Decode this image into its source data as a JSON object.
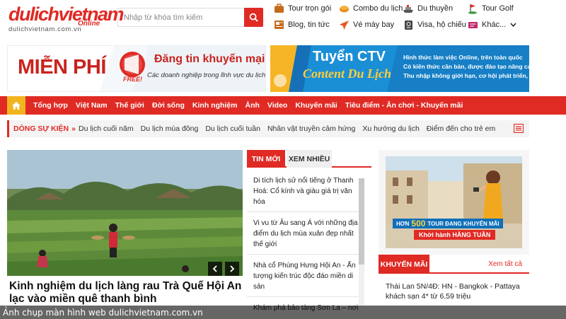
{
  "logo": {
    "main": "dulichvietnam",
    "online": "Online",
    "sub": "dulichvietnam.com.vn"
  },
  "search": {
    "placeholder": "Nhập từ khóa tìm kiếm"
  },
  "quick_links": [
    {
      "label": "Tour trọn gói",
      "icon": "briefcase-icon"
    },
    {
      "label": "Combo du lịch",
      "icon": "combo-icon"
    },
    {
      "label": "Du thuyền",
      "icon": "cruise-ship-icon"
    },
    {
      "label": "Tour Golf",
      "icon": "golf-icon"
    },
    {
      "label": "Blog, tin tức",
      "icon": "news-icon"
    },
    {
      "label": "Vé máy bay",
      "icon": "airplane-icon"
    },
    {
      "label": "Visa, hộ chiếu",
      "icon": "passport-icon"
    },
    {
      "label": "Khác...",
      "icon": "more-icon"
    }
  ],
  "banners": {
    "left": {
      "big": "MIỄN PHÍ",
      "badge": "FREE!",
      "heading": "Đăng tin khuyến mại",
      "sub": "Các doanh nghiệp trong lĩnh vực du lịch"
    },
    "right": {
      "line1": "Tuyển CTV",
      "line2": "Content Du Lịch",
      "desc1": "Hình thức làm việc Online, trên toàn quốc",
      "desc2": "Có kiến thức căn bản, được đào tạo nâng cao",
      "desc3": "Thu nhập không giới hạn, cơ hội phát triển,"
    }
  },
  "nav": [
    "Tổng hợp",
    "Việt Nam",
    "Thế giới",
    "Đời sống",
    "Kinh nghiệm",
    "Ảnh",
    "Video",
    "Khuyến mãi",
    "Tiêu điểm - Ăn chơi - Khuyến mãi"
  ],
  "events": {
    "title": "DÒNG SỰ KIỆN",
    "arrow": "»",
    "items": [
      "Du lịch cuối năm",
      "Du lịch mùa đông",
      "Du lịch cuối tuần",
      "Nhân vật truyền cảm hứng",
      "Xu hướng du lịch",
      "Điểm đến cho trẻ em"
    ]
  },
  "featured": {
    "title": "Kinh nghiệm du lịch làng rau Trà Quế Hội An lạc vào miền quê thanh bình"
  },
  "tabs": {
    "active": "TIN MỚI",
    "inactive": "XEM NHIỀU"
  },
  "news": [
    "Di tích lịch sử nổi tiếng ở Thanh Hoá: Cổ kính và giàu giá trị văn hóa",
    "Vi vu từ Âu sang Á với những địa điểm du lịch mùa xuân đẹp nhất thế giới",
    "Nhà cổ Phùng Hưng Hội An - Ấn tượng kiến trúc độc đáo miền di sản",
    "Khám phá bảo tàng Sơn La – nơi"
  ],
  "promo": {
    "line1_pre": "HƠN",
    "line1_num": "500",
    "line1_post": "TOUR ĐANG KHUYẾN MÃI",
    "line2": "Khởi hành HẰNG TUẦN"
  },
  "khuyen_mai": {
    "label": "KHUYẾN MÃI",
    "view_all": "Xem tất cả",
    "item": "Thái Lan 5N/4Đ: HN - Bangkok - Pattaya khách sạn 4* từ 6,59 triệu"
  },
  "caption": "Ảnh chụp màn hình web dulichvietnam.com.vn"
}
